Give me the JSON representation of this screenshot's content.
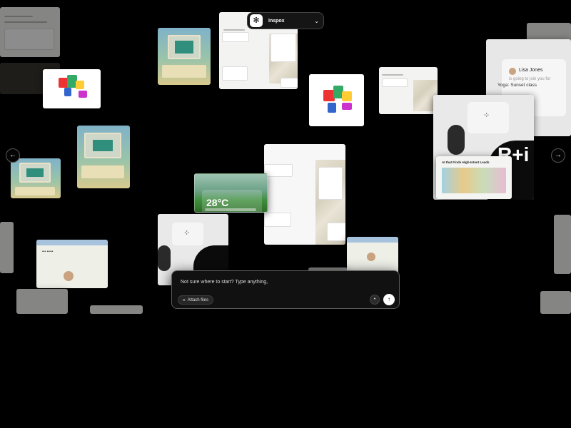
{
  "header": {
    "workspace_name": "Inspox",
    "logo_glyph": "✻",
    "chevron_icon": "chevron-down-icon"
  },
  "navigation": {
    "prev_label": "←",
    "next_label": "→"
  },
  "gallery": {
    "profile_card": {
      "name": "Lisa Jones",
      "status": "is going to join you for",
      "event": "Yoga: Sunset class"
    },
    "weather_card": {
      "temperature": "28°C"
    },
    "brand_card": {
      "wordmark": "R+i"
    },
    "promo_card": {
      "headline": "AI that Finds High-Intent Leads"
    }
  },
  "composer": {
    "placeholder": "Not sure where to start? Type anything,",
    "attach_label": "Attach files",
    "mic_icon": "mic-icon",
    "send_icon": "arrow-up-icon"
  },
  "colors": {
    "background": "#000000",
    "composer_bg": "#111111",
    "composer_border": "#5a5a5a",
    "send_button": "#ffffff"
  }
}
